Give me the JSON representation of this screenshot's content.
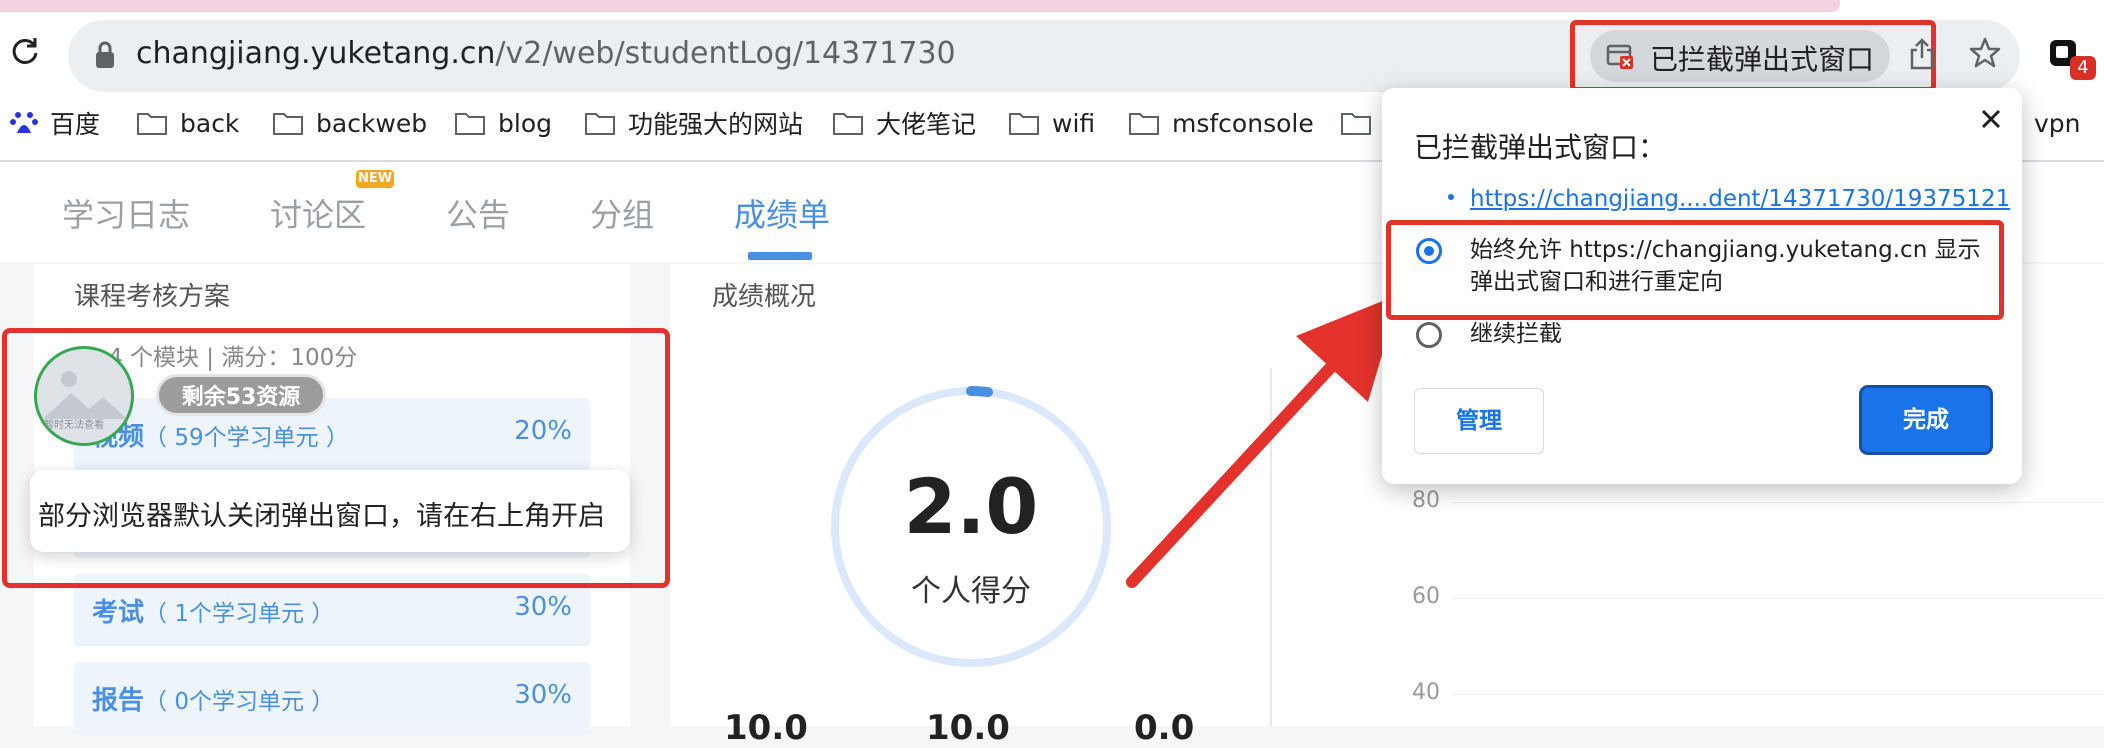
{
  "browser": {
    "url_host": "changjiang.yuketang.cn",
    "url_path": "/v2/web/studentLog/14371730",
    "blocked_chip_label": "已拦截弹出式窗口",
    "extension_badge": "4"
  },
  "bookmarks": [
    "百度",
    "back",
    "backweb",
    "blog",
    "功能强大的网站",
    "大佬笔记",
    "wifi",
    "msfconsole",
    "vpn"
  ],
  "tabs": {
    "items": [
      "学习日志",
      "讨论区",
      "公告",
      "分组",
      "成绩单"
    ],
    "new_badge": "NEW",
    "active": "成绩单"
  },
  "left_panel": {
    "title": "课程考核方案",
    "module_info": "4 个模块 | 满分：100分",
    "rows": [
      {
        "name": "视频",
        "sub": "（ 59个学习单元 ）",
        "pct": "20%"
      },
      {
        "name": "考试",
        "sub": "（ 1个学习单元 ）",
        "pct": "30%"
      },
      {
        "name": "报告",
        "sub": "（ 0个学习单元 ）",
        "pct": "30%"
      }
    ],
    "avatar_caption": "暂时无法查看",
    "resource_pill": "剩余53资源",
    "tooltip": "部分浏览器默认关闭弹出窗口，请在右上角开启"
  },
  "score": {
    "section_title": "成绩概况",
    "value": "2.0",
    "label": "个人得分",
    "y_ticks": [
      "80",
      "60",
      "40"
    ],
    "bottom_values": [
      "10.0",
      "10.0",
      "0.0"
    ]
  },
  "popup": {
    "title": "已拦截弹出式窗口：",
    "blocked_link": "https://changjiang....dent/14371730/19375121",
    "option_allow": "始终允许 https://changjiang.yuketang.cn 显示弹出式窗口和进行重定向",
    "option_allow_line1": "始终允许 https://changjiang.yuketang.cn 显示",
    "option_allow_line2": "弹出式窗口和进行重定向",
    "option_block": "继续拦截",
    "manage_label": "管理",
    "done_label": "完成"
  },
  "colors": {
    "accent": "#4a90e2",
    "chrome_blue": "#1a73e8",
    "annotation_red": "#e3322b",
    "avatar_ring": "#34a853"
  }
}
